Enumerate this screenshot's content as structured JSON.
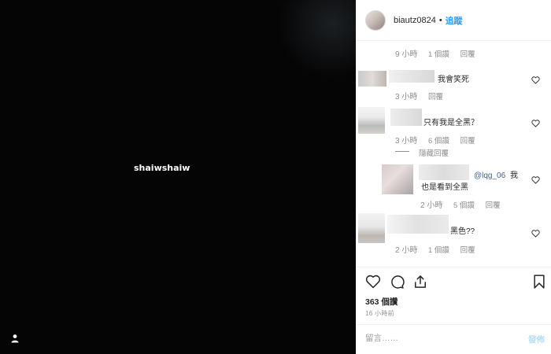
{
  "post": {
    "username": "biautz0824",
    "separator": "•",
    "follow_label": "追蹤",
    "media_tag": "shaiwshaiw",
    "likes_label": "363 個讚",
    "time_ago": "16 小時前"
  },
  "comments": [
    {
      "text": "",
      "time": "9 小時",
      "likes": "1 個讚",
      "reply": "回覆"
    },
    {
      "text": "我會笑死",
      "time": "3 小時",
      "reply": "回覆"
    },
    {
      "text": "只有我是全黑？",
      "time": "3 小時",
      "likes": "6 個讚",
      "reply": "回覆",
      "hide_replies": "隱藏回覆"
    },
    {
      "mention": "@lqg_06",
      "text_tail": "我",
      "text_line2": "也是看到全黑",
      "time": "2 小時",
      "likes": "5 個讚",
      "reply": "回覆"
    },
    {
      "text": "黑色??",
      "time": "2 小時",
      "likes": "1 個讚",
      "reply": "回覆"
    }
  ],
  "input": {
    "placeholder": "留言……",
    "post_label": "發佈"
  },
  "icons": [
    "user-tag-icon",
    "heart-icon",
    "comment-icon",
    "share-icon",
    "bookmark-icon"
  ],
  "colors": {
    "accent": "#3897f0",
    "post_disabled": "#b2dffc",
    "muted": "#8e8e8e"
  }
}
